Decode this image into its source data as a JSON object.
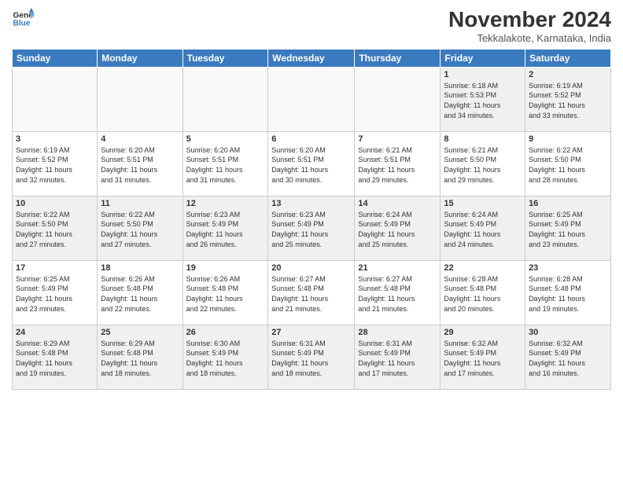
{
  "logo": {
    "line1": "General",
    "line2": "Blue"
  },
  "title": "November 2024",
  "location": "Tekkalakote, Karnataka, India",
  "headers": [
    "Sunday",
    "Monday",
    "Tuesday",
    "Wednesday",
    "Thursday",
    "Friday",
    "Saturday"
  ],
  "weeks": [
    [
      {
        "day": "",
        "info": ""
      },
      {
        "day": "",
        "info": ""
      },
      {
        "day": "",
        "info": ""
      },
      {
        "day": "",
        "info": ""
      },
      {
        "day": "",
        "info": ""
      },
      {
        "day": "1",
        "info": "Sunrise: 6:18 AM\nSunset: 5:53 PM\nDaylight: 11 hours\nand 34 minutes."
      },
      {
        "day": "2",
        "info": "Sunrise: 6:19 AM\nSunset: 5:52 PM\nDaylight: 11 hours\nand 33 minutes."
      }
    ],
    [
      {
        "day": "3",
        "info": "Sunrise: 6:19 AM\nSunset: 5:52 PM\nDaylight: 11 hours\nand 32 minutes."
      },
      {
        "day": "4",
        "info": "Sunrise: 6:20 AM\nSunset: 5:51 PM\nDaylight: 11 hours\nand 31 minutes."
      },
      {
        "day": "5",
        "info": "Sunrise: 6:20 AM\nSunset: 5:51 PM\nDaylight: 11 hours\nand 31 minutes."
      },
      {
        "day": "6",
        "info": "Sunrise: 6:20 AM\nSunset: 5:51 PM\nDaylight: 11 hours\nand 30 minutes."
      },
      {
        "day": "7",
        "info": "Sunrise: 6:21 AM\nSunset: 5:51 PM\nDaylight: 11 hours\nand 29 minutes."
      },
      {
        "day": "8",
        "info": "Sunrise: 6:21 AM\nSunset: 5:50 PM\nDaylight: 11 hours\nand 29 minutes."
      },
      {
        "day": "9",
        "info": "Sunrise: 6:22 AM\nSunset: 5:50 PM\nDaylight: 11 hours\nand 28 minutes."
      }
    ],
    [
      {
        "day": "10",
        "info": "Sunrise: 6:22 AM\nSunset: 5:50 PM\nDaylight: 11 hours\nand 27 minutes."
      },
      {
        "day": "11",
        "info": "Sunrise: 6:22 AM\nSunset: 5:50 PM\nDaylight: 11 hours\nand 27 minutes."
      },
      {
        "day": "12",
        "info": "Sunrise: 6:23 AM\nSunset: 5:49 PM\nDaylight: 11 hours\nand 26 minutes."
      },
      {
        "day": "13",
        "info": "Sunrise: 6:23 AM\nSunset: 5:49 PM\nDaylight: 11 hours\nand 25 minutes."
      },
      {
        "day": "14",
        "info": "Sunrise: 6:24 AM\nSunset: 5:49 PM\nDaylight: 11 hours\nand 25 minutes."
      },
      {
        "day": "15",
        "info": "Sunrise: 6:24 AM\nSunset: 5:49 PM\nDaylight: 11 hours\nand 24 minutes."
      },
      {
        "day": "16",
        "info": "Sunrise: 6:25 AM\nSunset: 5:49 PM\nDaylight: 11 hours\nand 23 minutes."
      }
    ],
    [
      {
        "day": "17",
        "info": "Sunrise: 6:25 AM\nSunset: 5:49 PM\nDaylight: 11 hours\nand 23 minutes."
      },
      {
        "day": "18",
        "info": "Sunrise: 6:26 AM\nSunset: 5:48 PM\nDaylight: 11 hours\nand 22 minutes."
      },
      {
        "day": "19",
        "info": "Sunrise: 6:26 AM\nSunset: 5:48 PM\nDaylight: 11 hours\nand 22 minutes."
      },
      {
        "day": "20",
        "info": "Sunrise: 6:27 AM\nSunset: 5:48 PM\nDaylight: 11 hours\nand 21 minutes."
      },
      {
        "day": "21",
        "info": "Sunrise: 6:27 AM\nSunset: 5:48 PM\nDaylight: 11 hours\nand 21 minutes."
      },
      {
        "day": "22",
        "info": "Sunrise: 6:28 AM\nSunset: 5:48 PM\nDaylight: 11 hours\nand 20 minutes."
      },
      {
        "day": "23",
        "info": "Sunrise: 6:28 AM\nSunset: 5:48 PM\nDaylight: 11 hours\nand 19 minutes."
      }
    ],
    [
      {
        "day": "24",
        "info": "Sunrise: 6:29 AM\nSunset: 5:48 PM\nDaylight: 11 hours\nand 19 minutes."
      },
      {
        "day": "25",
        "info": "Sunrise: 6:29 AM\nSunset: 5:48 PM\nDaylight: 11 hours\nand 18 minutes."
      },
      {
        "day": "26",
        "info": "Sunrise: 6:30 AM\nSunset: 5:49 PM\nDaylight: 11 hours\nand 18 minutes."
      },
      {
        "day": "27",
        "info": "Sunrise: 6:31 AM\nSunset: 5:49 PM\nDaylight: 11 hours\nand 18 minutes."
      },
      {
        "day": "28",
        "info": "Sunrise: 6:31 AM\nSunset: 5:49 PM\nDaylight: 11 hours\nand 17 minutes."
      },
      {
        "day": "29",
        "info": "Sunrise: 6:32 AM\nSunset: 5:49 PM\nDaylight: 11 hours\nand 17 minutes."
      },
      {
        "day": "30",
        "info": "Sunrise: 6:32 AM\nSunset: 5:49 PM\nDaylight: 11 hours\nand 16 minutes."
      }
    ]
  ]
}
